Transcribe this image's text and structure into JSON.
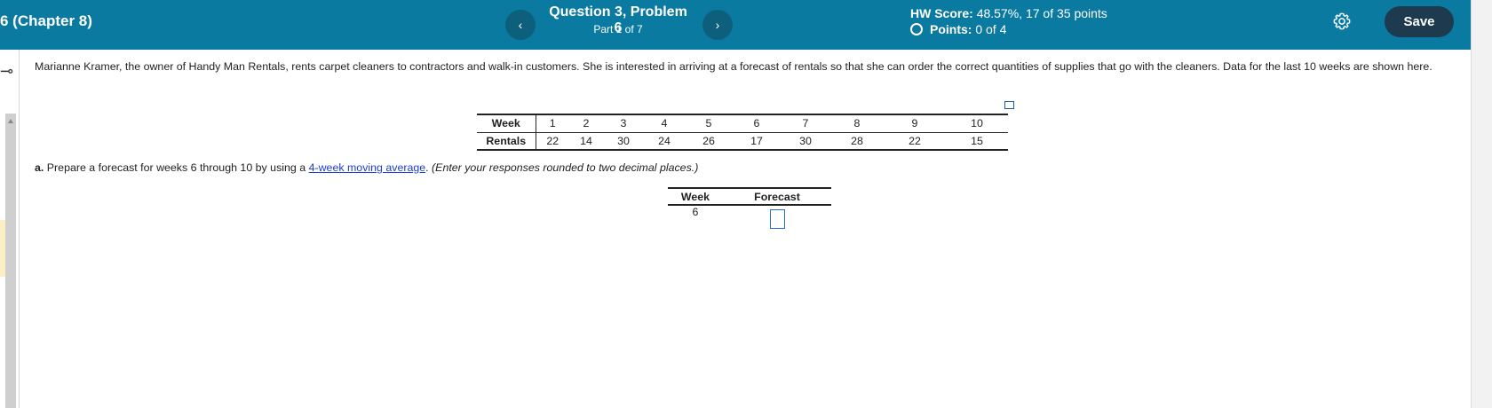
{
  "header": {
    "assignment_title": "6 (Chapter 8)",
    "question_title": "Question 3, Problem 6",
    "part": "Part 1 of 7",
    "prev_icon": "chevron-left-icon",
    "next_icon": "chevron-right-icon",
    "hw_score_label": "HW Score:",
    "hw_score_value": "48.57%, 17 of 35 points",
    "points_label": "Points:",
    "points_value": "0 of 4",
    "settings_icon": "gear-icon",
    "save_label": "Save",
    "accent_color": "#0a7aa0",
    "save_color": "#1d3a4e"
  },
  "problem": {
    "intro": "Marianne Kramer, the owner of Handy Man Rentals, rents carpet cleaners to contractors and walk-in customers. She is interested in arriving at a forecast of rentals so that she can order the correct quantities of supplies that go with the cleaners. Data for the last 10 weeks are shown here.",
    "data_table": {
      "row_labels": [
        "Week",
        "Rentals"
      ],
      "weeks": [
        "1",
        "2",
        "3",
        "4",
        "5",
        "6",
        "7",
        "8",
        "9",
        "10"
      ],
      "rentals": [
        "22",
        "14",
        "30",
        "24",
        "26",
        "17",
        "30",
        "28",
        "22",
        "15"
      ]
    },
    "part_a": {
      "letter": "a.",
      "text_before_link": " Prepare a forecast for weeks 6 through 10 by using a ",
      "link_text": "4-week moving average",
      "text_after_link": ".",
      "instruction": " (Enter your responses rounded to two decimal places.)"
    },
    "forecast_table": {
      "headers": [
        "Week",
        "Forecast"
      ],
      "rows": [
        {
          "week": "6",
          "forecast": ""
        }
      ]
    }
  }
}
